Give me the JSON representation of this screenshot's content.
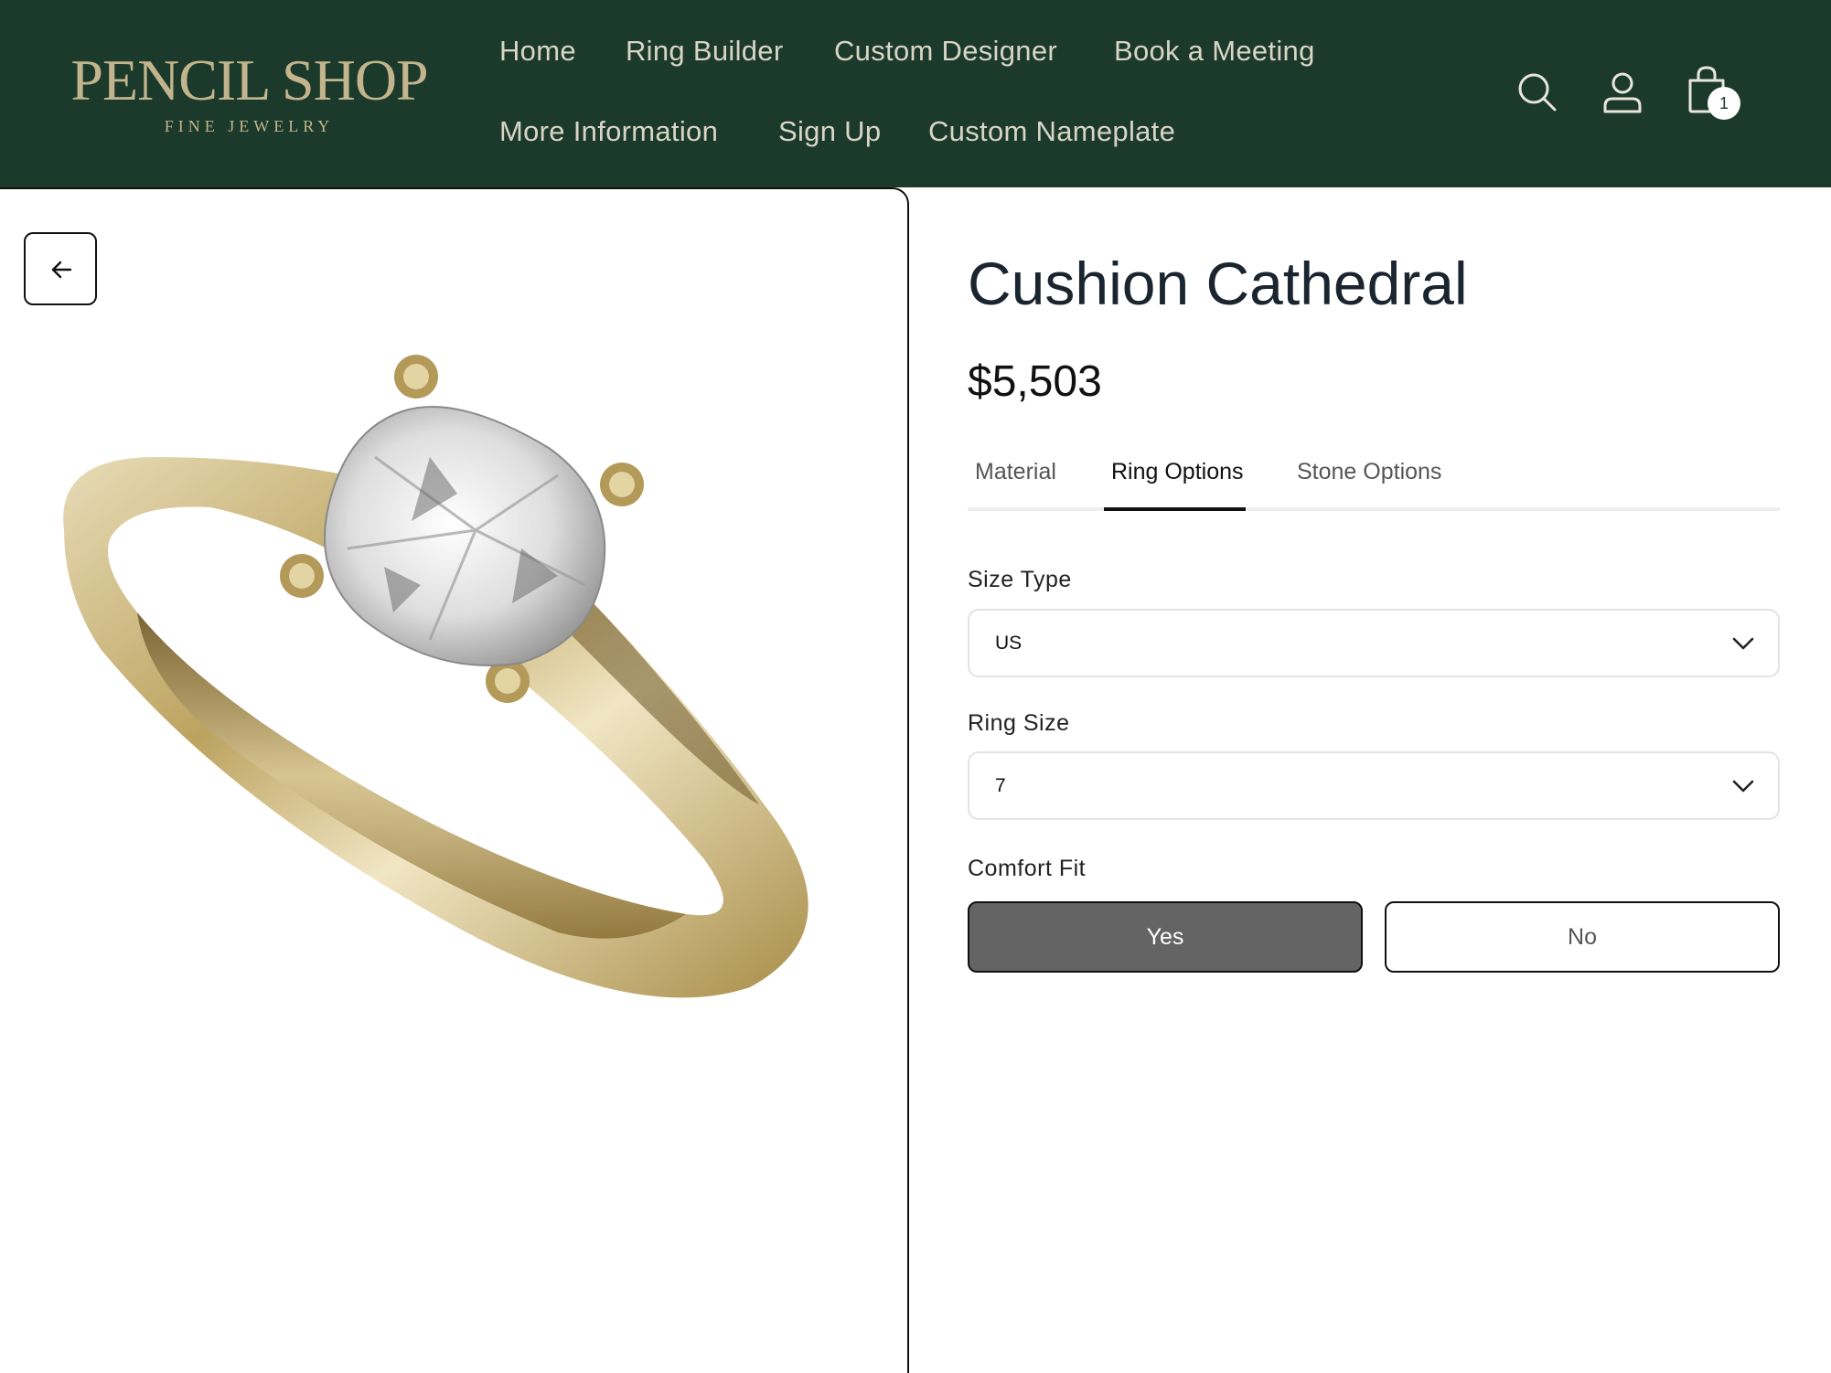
{
  "header": {
    "logo_main": "PENCIL SHOP",
    "logo_sub": "FINE JEWELRY",
    "nav": [
      "Home",
      "Ring Builder",
      "Custom Designer",
      "Book a Meeting",
      "More Information",
      "Sign Up",
      "Custom Nameplate"
    ],
    "cart_count": "1",
    "icons": [
      "search-icon",
      "user-icon",
      "shopping-bag-icon"
    ],
    "colors": {
      "background": "#1c3a2b",
      "logo": "#c2b48c",
      "nav_text": "#d8d5c6"
    }
  },
  "product": {
    "title": "Cushion Cathedral",
    "price": "$5,503",
    "tabs": [
      "Material",
      "Ring Options",
      "Stone Options"
    ],
    "active_tab": "Ring Options",
    "size_type": {
      "label": "Size Type",
      "value": "US"
    },
    "ring_size": {
      "label": "Ring Size",
      "value": "7"
    },
    "comfort_fit": {
      "label": "Comfort Fit",
      "options": [
        "Yes",
        "No"
      ],
      "selected": "Yes"
    }
  },
  "image": {
    "back_icon": "arrow-left-icon",
    "subject": "ring-image"
  }
}
